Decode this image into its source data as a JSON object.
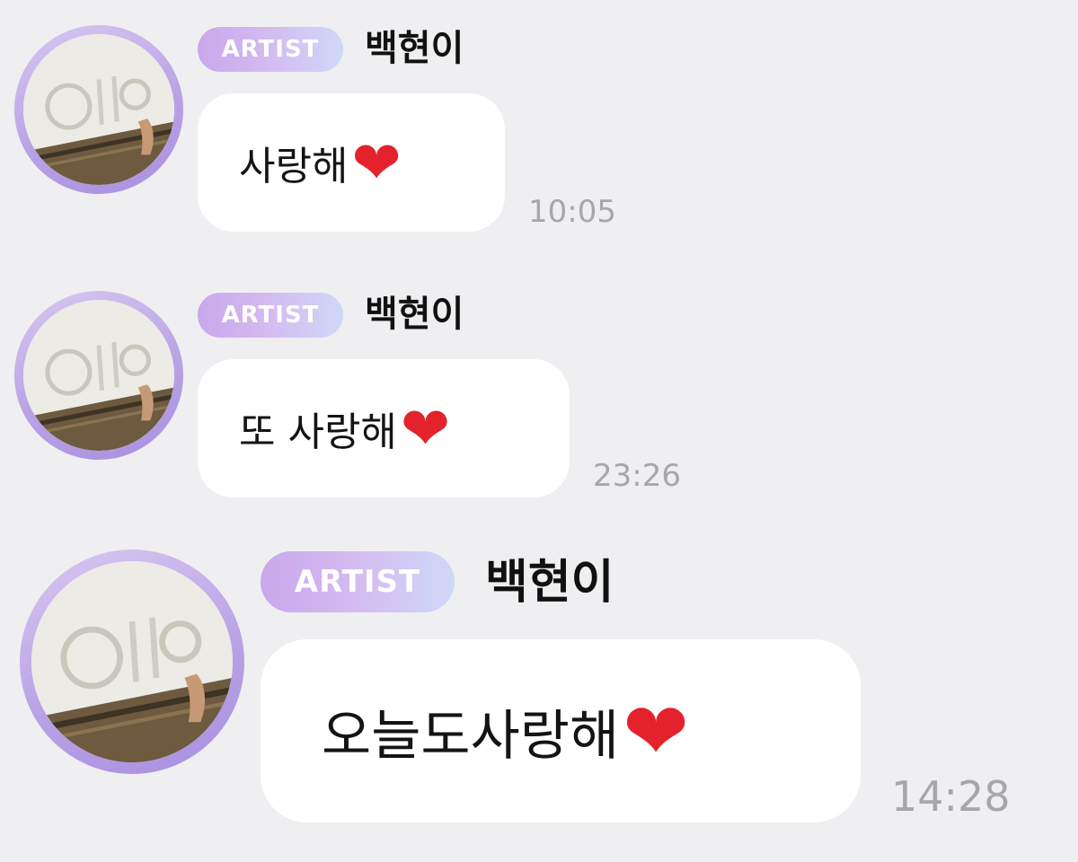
{
  "messages": [
    {
      "badge": "ARTIST",
      "sender": "백현이",
      "text": "사랑해",
      "emoji": "❤",
      "time": "10:05"
    },
    {
      "badge": "ARTIST",
      "sender": "백현이",
      "text": "또 사랑해",
      "emoji": "❤",
      "time": "23:26"
    },
    {
      "badge": "ARTIST",
      "sender": "백현이",
      "text": "오늘도사랑해",
      "emoji": "❤",
      "time": "14:28"
    }
  ],
  "colors": {
    "background": "#efeff1",
    "bubble": "#ffffff",
    "heart": "#e3222b",
    "badge_gradient_start": "#c9a7ec",
    "badge_gradient_end": "#cfd8f8",
    "avatar_ring": "#b9a3e6",
    "timestamp": "#a7a7aa"
  },
  "icons": {
    "avatar": "profile-photo-snow-drawing",
    "reaction": "red-heart-emoji"
  }
}
